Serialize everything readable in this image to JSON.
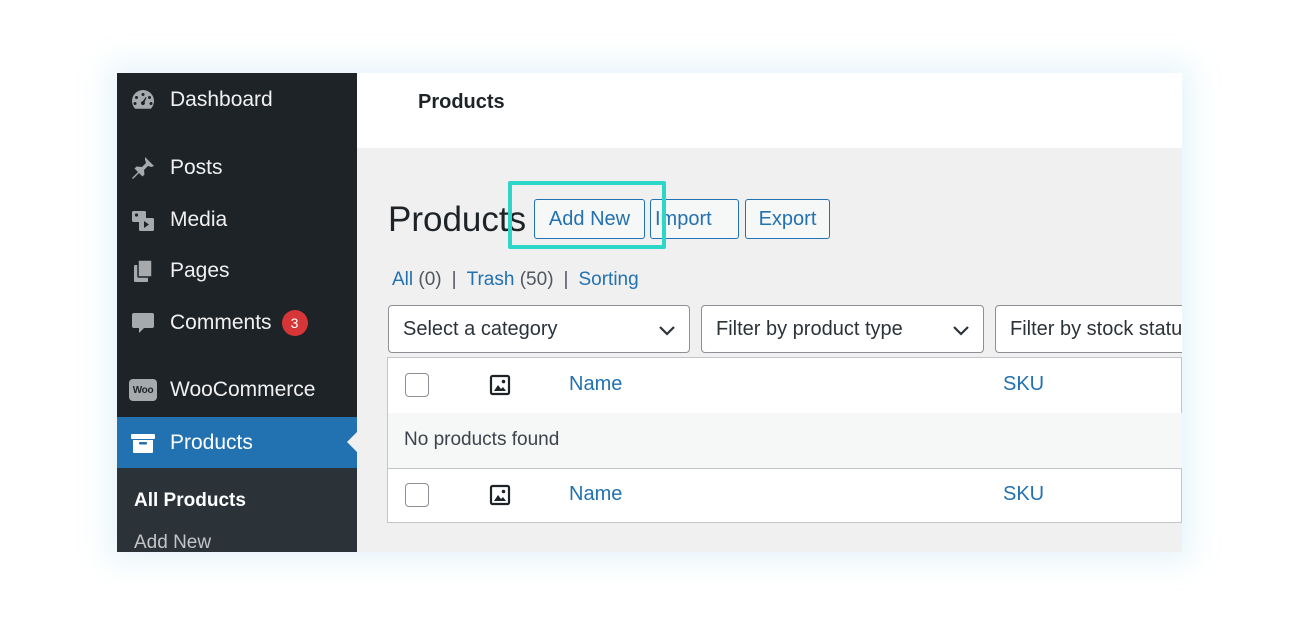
{
  "topbar": {
    "title": "Products"
  },
  "sidebar": {
    "items": [
      {
        "label": "Dashboard",
        "icon": "dashboard-icon"
      },
      {
        "label": "Posts",
        "icon": "pin-icon"
      },
      {
        "label": "Media",
        "icon": "media-icon"
      },
      {
        "label": "Pages",
        "icon": "pages-icon"
      },
      {
        "label": "Comments",
        "icon": "comment-icon",
        "badge": "3"
      },
      {
        "label": "WooCommerce",
        "icon": "woo-icon",
        "icon_text": "Woo"
      },
      {
        "label": "Products",
        "icon": "archive-icon",
        "active": true
      }
    ],
    "submenu": [
      {
        "label": "All Products",
        "current": true
      },
      {
        "label": "Add New"
      }
    ]
  },
  "main": {
    "title": "Products",
    "buttons": {
      "add_new": "Add New",
      "import": "Import",
      "export": "Export"
    },
    "filters_links": [
      {
        "label": "All",
        "count": "(0)"
      },
      {
        "label": "Trash",
        "count": "(50)"
      },
      {
        "label": "Sorting"
      }
    ],
    "selects": {
      "category": "Select a category",
      "product_type": "Filter by product type",
      "stock_status": "Filter by stock status"
    },
    "table": {
      "columns": {
        "name": "Name",
        "sku": "SKU"
      },
      "empty_message": "No products found"
    }
  },
  "colors": {
    "sidebar_bg": "#1d2327",
    "active_bg": "#2271b1",
    "link": "#2271b1",
    "badge": "#d63638",
    "highlight": "#2ed6c8"
  }
}
